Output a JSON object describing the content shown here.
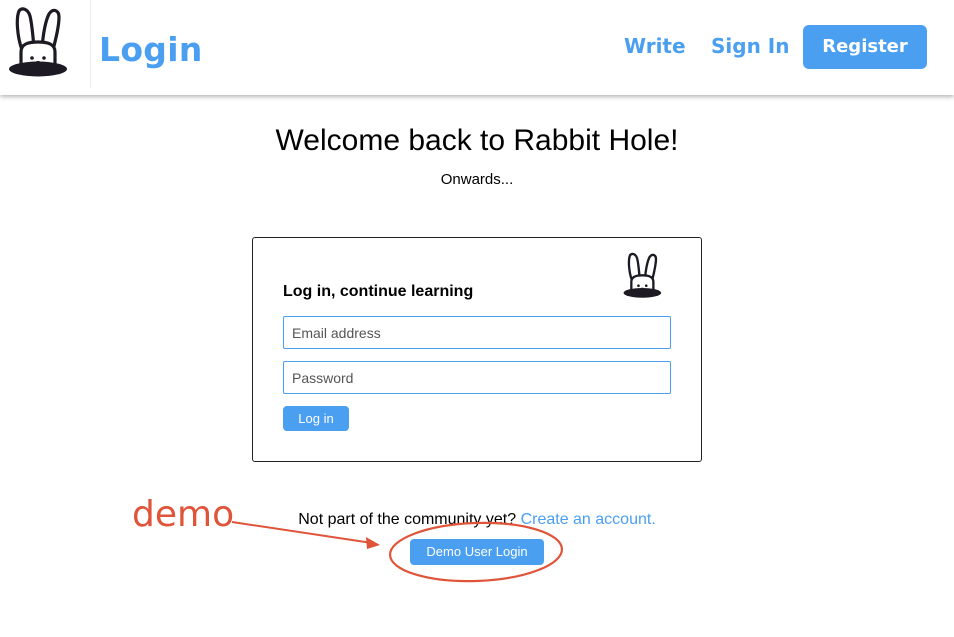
{
  "nav": {
    "title": "Login",
    "links": [
      "Write",
      "Sign In"
    ],
    "register": "Register"
  },
  "hero": {
    "title": "Welcome back to Rabbit Hole!",
    "subtitle": "Onwards..."
  },
  "login_form": {
    "heading": "Log in, continue learning",
    "email_placeholder": "Email address",
    "password_placeholder": "Password",
    "submit": "Log in"
  },
  "footer": {
    "prompt": "Not part of the community yet?",
    "create_link": "Create an account.",
    "demo_button": "Demo User Login"
  },
  "annotation": {
    "label": "demo",
    "color": "#e0543a"
  },
  "colors": {
    "accent": "#4a9ff0",
    "text": "#000000"
  },
  "icons": {
    "logo": "rabbit-in-hole-icon"
  }
}
